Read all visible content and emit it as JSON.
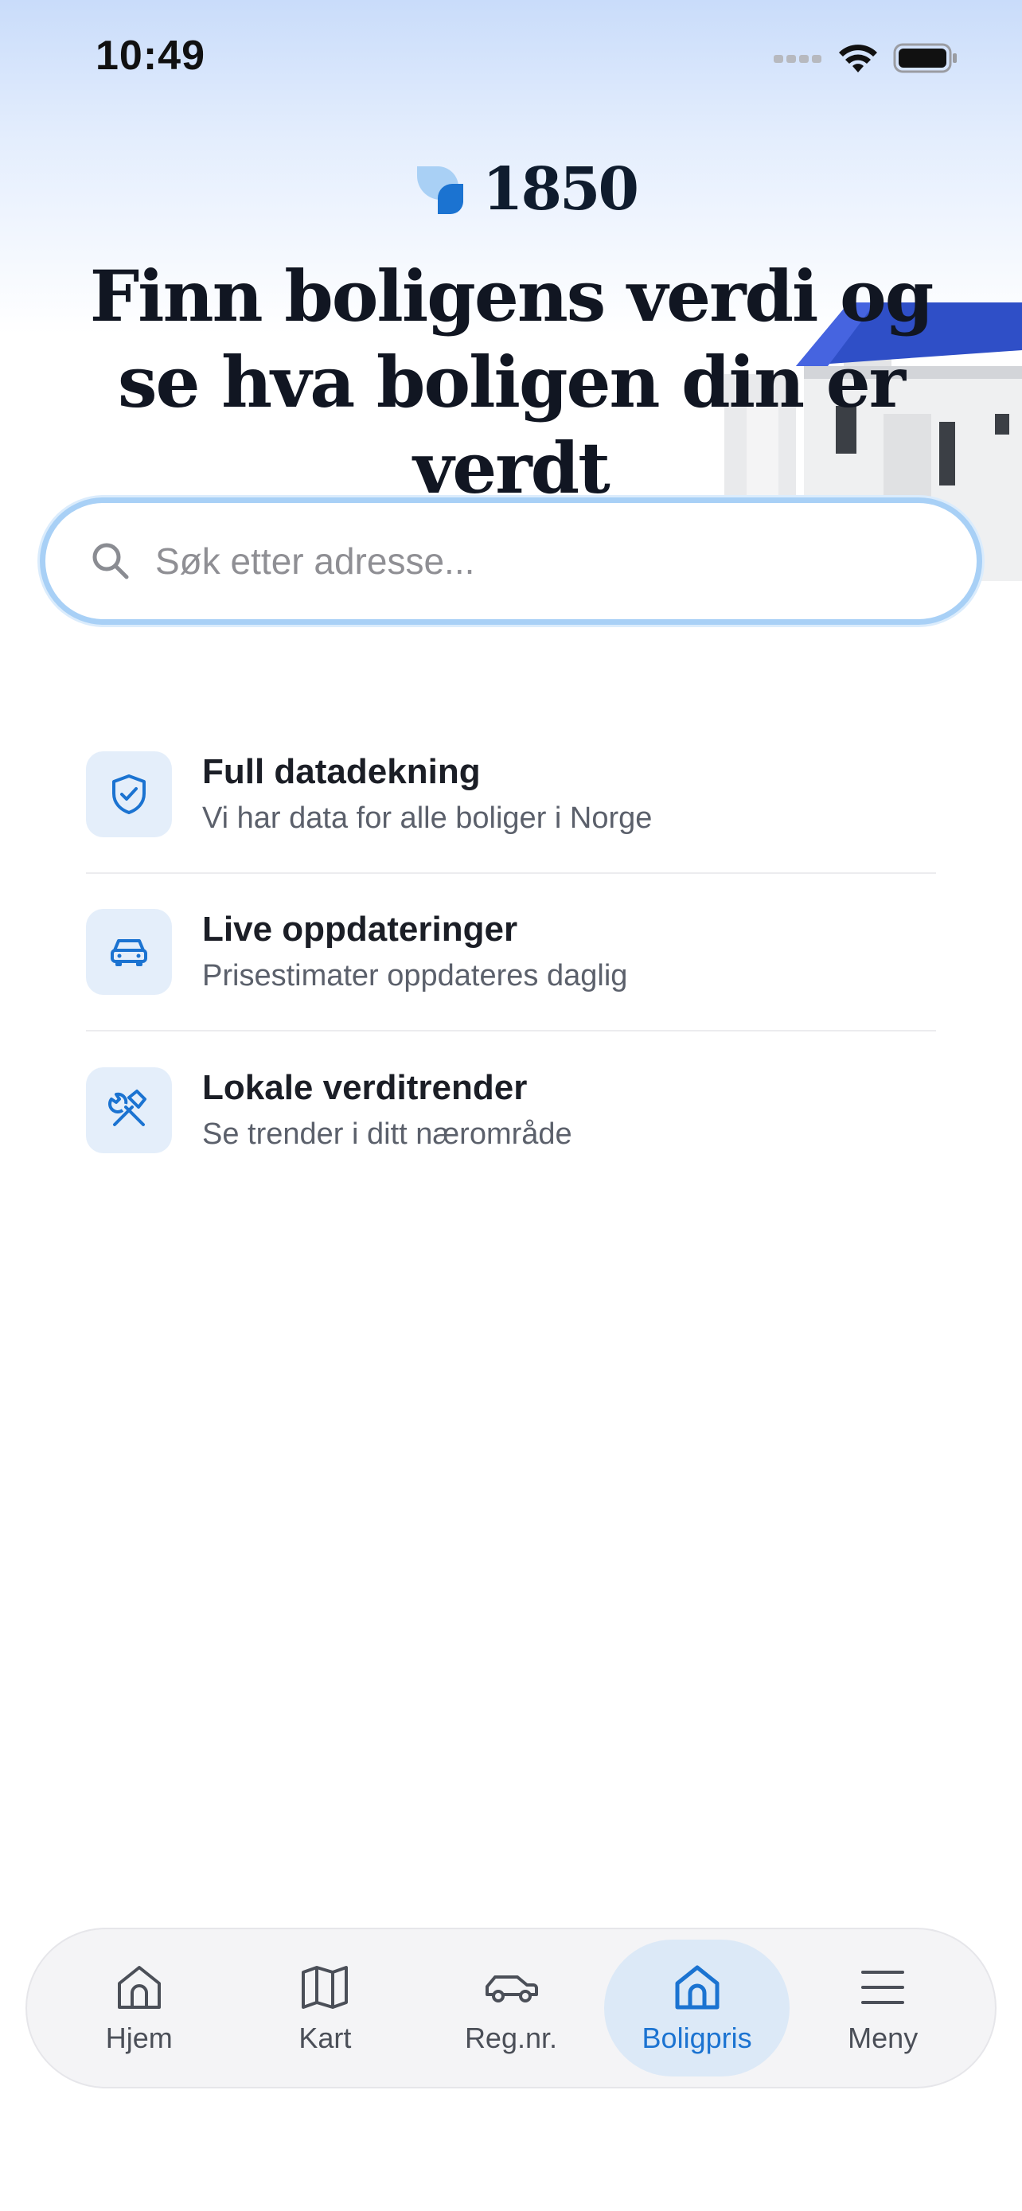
{
  "status_bar": {
    "time": "10:49"
  },
  "logo": {
    "text": "1850"
  },
  "headline": "Finn boligens verdi og se hva boligen din er verdt",
  "search": {
    "placeholder": "Søk etter adresse..."
  },
  "features": [
    {
      "icon": "shield-check-icon",
      "title": "Full datadekning",
      "subtitle": "Vi har data for alle boliger i Norge"
    },
    {
      "icon": "car-icon",
      "title": "Live oppdateringer",
      "subtitle": "Prisestimater oppdateres daglig"
    },
    {
      "icon": "tools-icon",
      "title": "Lokale verditrender",
      "subtitle": "Se trender i ditt nærområde"
    }
  ],
  "tabbar": {
    "items": [
      {
        "label": "Hjem",
        "icon": "home-icon",
        "active": false
      },
      {
        "label": "Kart",
        "icon": "map-icon",
        "active": false
      },
      {
        "label": "Reg.nr.",
        "icon": "car-icon",
        "active": false
      },
      {
        "label": "Boligpris",
        "icon": "house-icon",
        "active": true
      },
      {
        "label": "Meny",
        "icon": "menu-icon",
        "active": false
      }
    ]
  },
  "colors": {
    "accent": "#1b73d1",
    "search_border": "#a8d0f6",
    "icon_bg": "#e4eefa"
  }
}
